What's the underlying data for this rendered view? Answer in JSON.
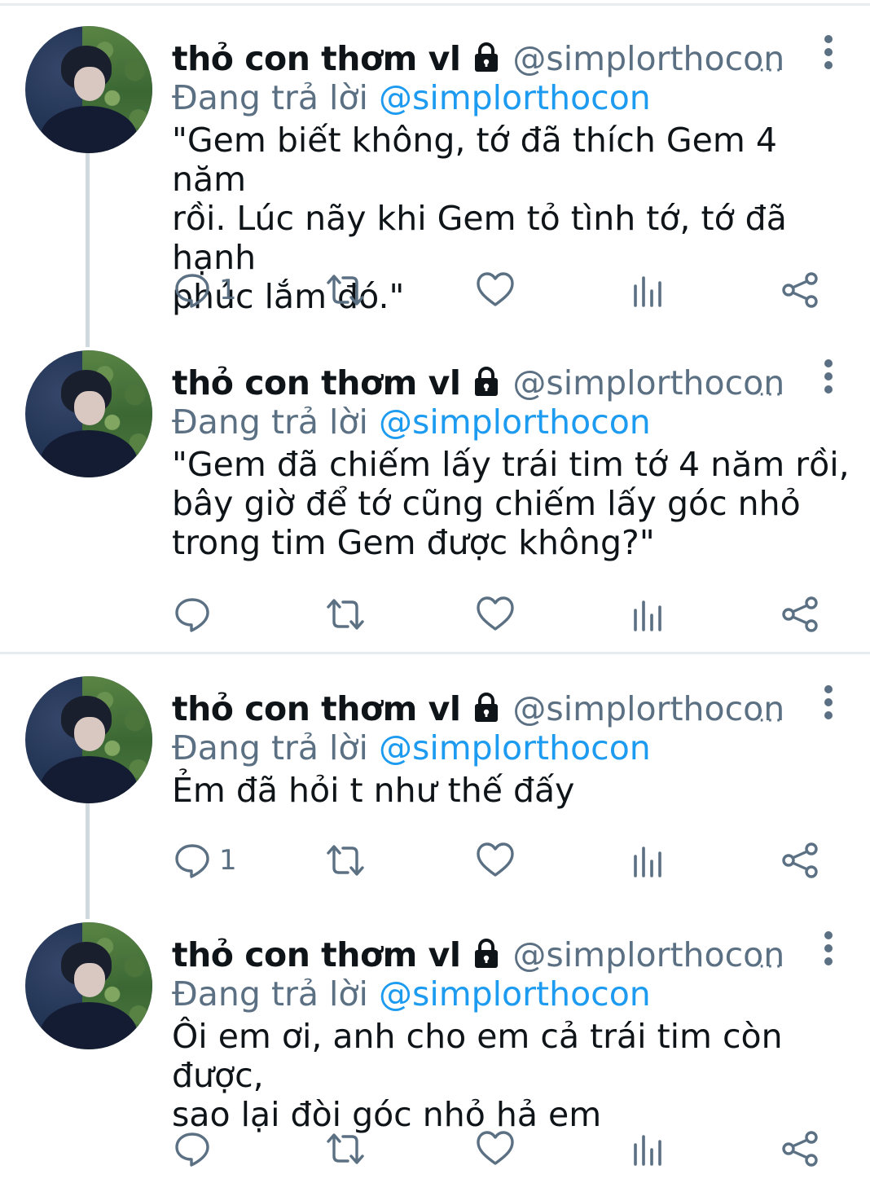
{
  "colors": {
    "text": "#0f1419",
    "secondary": "#5b7083",
    "accent_blue": "#1d9bf0",
    "divider": "#e6ecf0",
    "thread_line": "#cfd9de"
  },
  "tweets": [
    {
      "display_name": "thỏ con thơm vl",
      "handle": "@simplorthocon",
      "header_dots": "···",
      "reply_prefix": "Đang trả lời",
      "reply_to": "@simplorthocon",
      "text": "\"Gem biết không, tớ đã thích Gem 4 năm\nrồi. Lúc nãy khi Gem tỏ tình tớ, tớ đã hạnh\nphúc lắm đó.\"",
      "reply_count": "1",
      "icons": [
        "lock-icon",
        "more-vertical-icon",
        "reply-icon",
        "retweet-icon",
        "like-icon",
        "analytics-icon",
        "share-icon"
      ]
    },
    {
      "display_name": "thỏ con thơm vl",
      "handle": "@simplorthocon",
      "header_dots": "···",
      "reply_prefix": "Đang trả lời",
      "reply_to": "@simplorthocon",
      "text": "\"Gem đã chiếm lấy trái tim tớ 4 năm rồi,\nbây giờ để tớ cũng chiếm lấy góc nhỏ\ntrong tim Gem được không?\"",
      "reply_count": ""
    },
    {
      "display_name": "thỏ con thơm vl",
      "handle": "@simplorthocon",
      "header_dots": "···",
      "reply_prefix": "Đang trả lời",
      "reply_to": "@simplorthocon",
      "text": "Ẻm đã hỏi t như thế đấy",
      "reply_count": "1"
    },
    {
      "display_name": "thỏ con thơm vl",
      "handle": "@simplorthocon",
      "header_dots": "···",
      "reply_prefix": "Đang trả lời",
      "reply_to": "@simplorthocon",
      "text": "Ôi em ơi, anh cho em cả trái tim còn được,\nsao lại đòi góc nhỏ hả em",
      "reply_count": ""
    }
  ]
}
